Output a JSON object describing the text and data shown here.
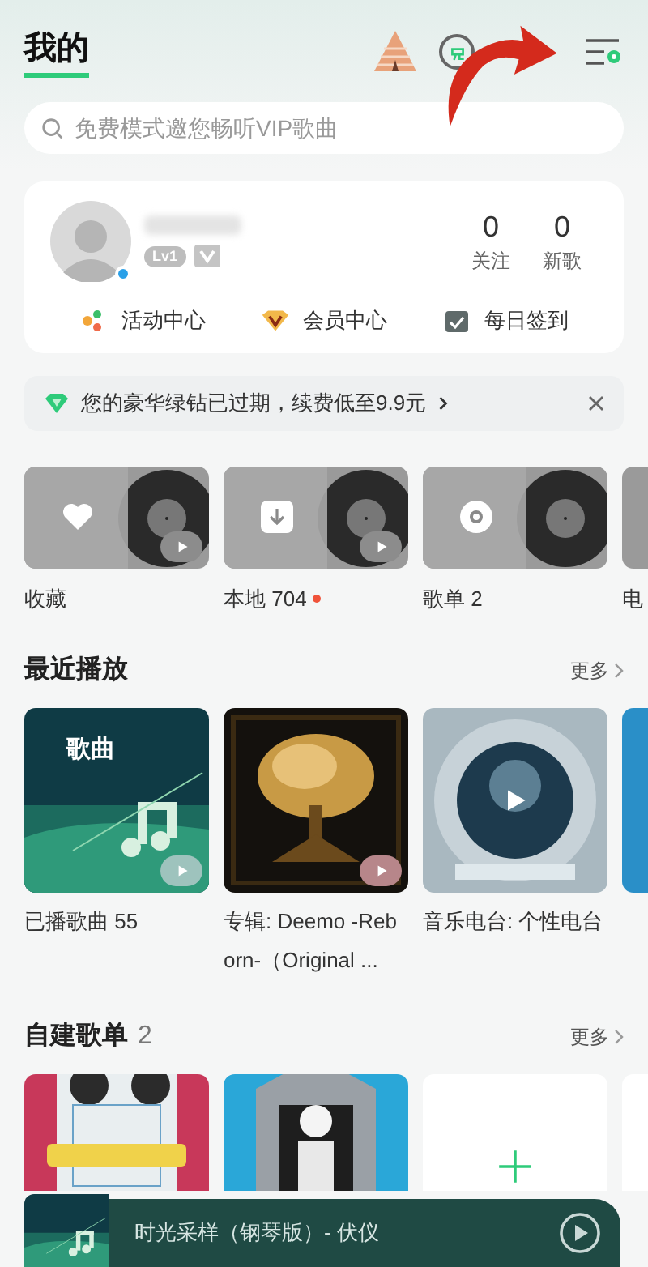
{
  "header": {
    "title": "我的"
  },
  "search": {
    "placeholder": "免费模式邀您畅听VIP歌曲"
  },
  "profile": {
    "level": "Lv1",
    "stats": [
      {
        "value": "0",
        "label": "关注"
      },
      {
        "value": "0",
        "label": "新歌"
      }
    ],
    "shortcuts": [
      {
        "kind": "activity",
        "label": "活动中心"
      },
      {
        "kind": "vip",
        "label": "会员中心"
      },
      {
        "kind": "checkin",
        "label": "每日签到"
      }
    ]
  },
  "banner": {
    "text": "您的豪华绿钻已过期，续费低至9.9元"
  },
  "quick": [
    {
      "kind": "favorites",
      "label": "收藏",
      "play": true,
      "new": false
    },
    {
      "kind": "local",
      "label": "本地 704",
      "play": true,
      "new": true
    },
    {
      "kind": "playlist",
      "label": "歌单 2",
      "play": false,
      "new": false
    },
    {
      "kind": "radio",
      "label": "电",
      "play": false,
      "new": false
    }
  ],
  "recent": {
    "title": "最近播放",
    "more": "更多",
    "items": [
      {
        "tag": "歌曲",
        "label": "已播歌曲 55"
      },
      {
        "label": "专辑: Deemo -Reborn-（Original ..."
      },
      {
        "label": "音乐电台: 个性电台"
      }
    ]
  },
  "playlists": {
    "title": "自建歌单",
    "count": "2",
    "more": "更多"
  },
  "player": {
    "title": "时光采样（钢琴版）- 伏仪"
  }
}
